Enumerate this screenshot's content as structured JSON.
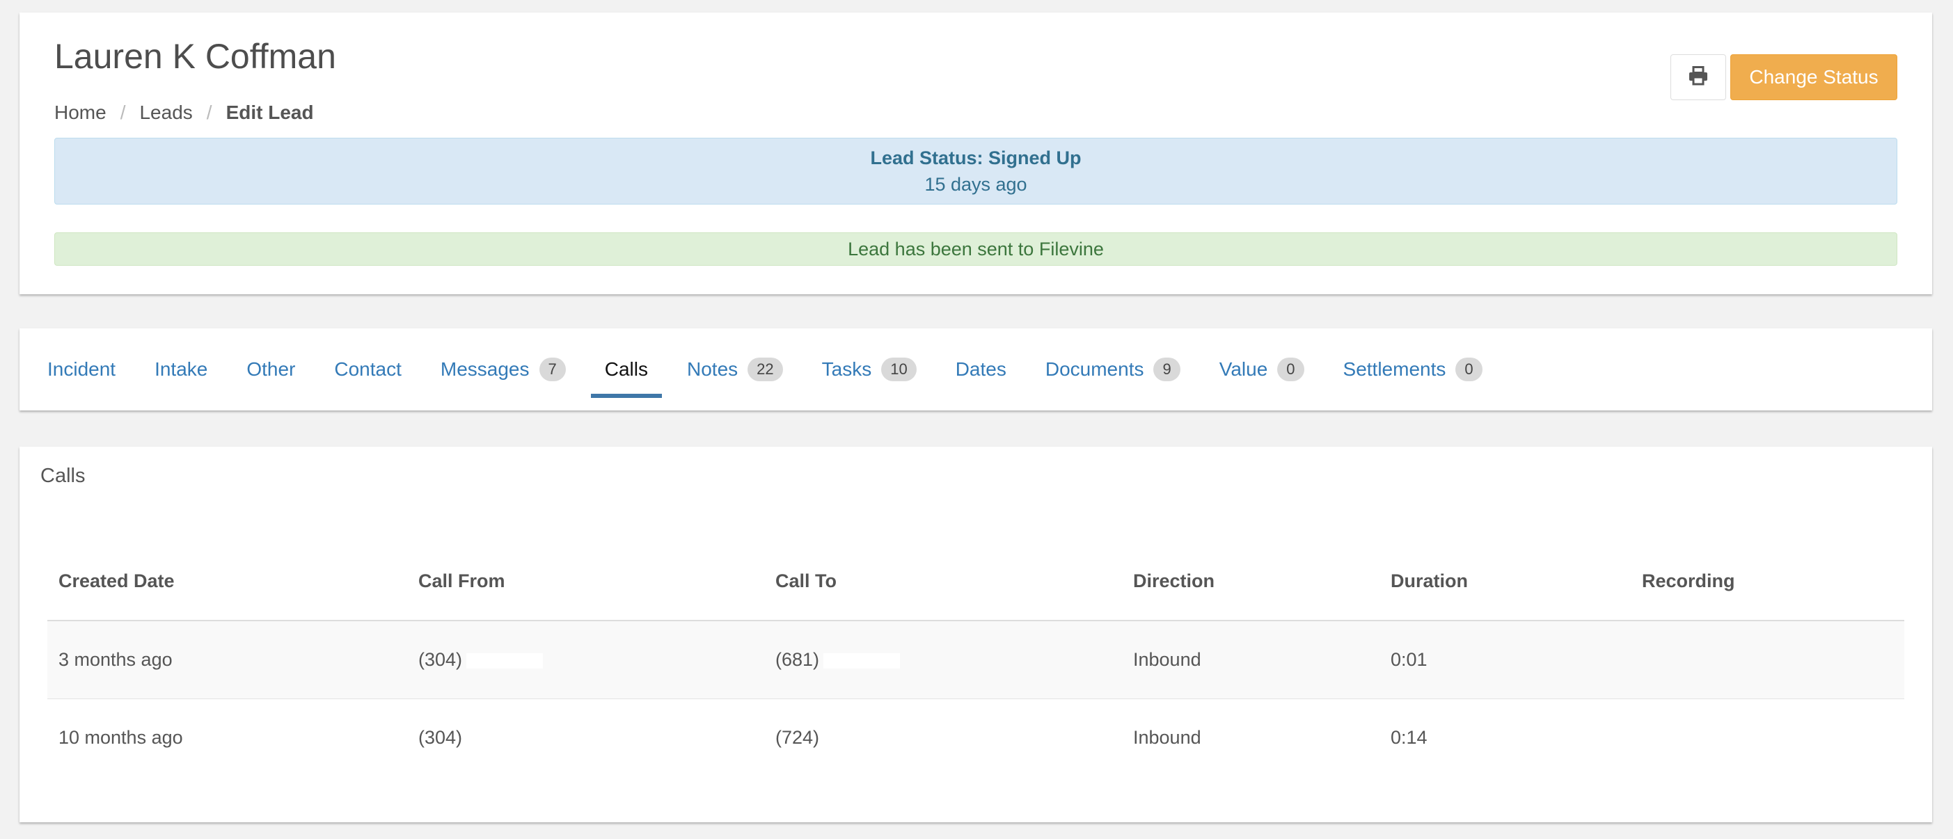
{
  "header": {
    "lead_name": "Lauren K Coffman",
    "breadcrumb": [
      "Home",
      "Leads",
      "Edit Lead"
    ],
    "print_icon": "printer-icon",
    "change_status_label": "Change Status",
    "lead_status_title": "Lead Status: Signed Up",
    "lead_status_time": "15 days ago",
    "filevine_message": "Lead has been sent to Filevine"
  },
  "tabs": [
    {
      "label": "Incident",
      "badge": null
    },
    {
      "label": "Intake",
      "badge": null
    },
    {
      "label": "Other",
      "badge": null
    },
    {
      "label": "Contact",
      "badge": null
    },
    {
      "label": "Messages",
      "badge": "7"
    },
    {
      "label": "Calls",
      "badge": null,
      "active": true
    },
    {
      "label": "Notes",
      "badge": "22"
    },
    {
      "label": "Tasks",
      "badge": "10"
    },
    {
      "label": "Dates",
      "badge": null
    },
    {
      "label": "Documents",
      "badge": "9"
    },
    {
      "label": "Value",
      "badge": "0"
    },
    {
      "label": "Settlements",
      "badge": "0"
    }
  ],
  "calls": {
    "title": "Calls",
    "columns": [
      "Created Date",
      "Call From",
      "Call To",
      "Direction",
      "Duration",
      "Recording"
    ],
    "rows": [
      {
        "created": "3 months ago",
        "from": "(304)",
        "to": "(681)",
        "direction": "Inbound",
        "duration": "0:01",
        "recording": ""
      },
      {
        "created": "10 months ago",
        "from": "(304)",
        "to": "(724)",
        "direction": "Inbound",
        "duration": "0:14",
        "recording": ""
      }
    ]
  },
  "colors": {
    "accent": "#337ab7",
    "warning": "#f0ad4e",
    "info_bg": "#d9e8f5",
    "success_bg": "#dff0d8"
  }
}
